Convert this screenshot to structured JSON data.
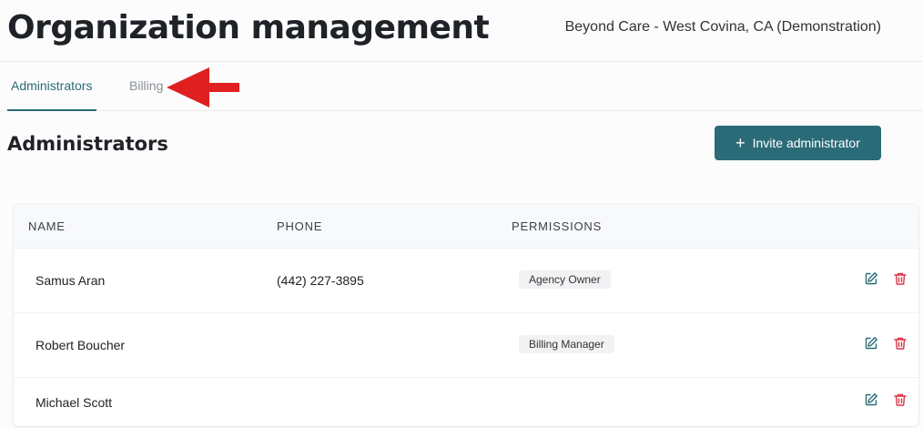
{
  "header": {
    "title": "Organization management",
    "org_name": "Beyond Care - West Covina, CA (Demonstration)"
  },
  "tabs": [
    {
      "label": "Administrators",
      "active": true
    },
    {
      "label": "Billing",
      "active": false
    }
  ],
  "section": {
    "title": "Administrators",
    "invite_button": "Invite administrator"
  },
  "table": {
    "columns": [
      "NAME",
      "PHONE",
      "PERMISSIONS"
    ],
    "rows": [
      {
        "name": "Samus Aran",
        "phone": "(442) 227-3895",
        "permission": "Agency Owner"
      },
      {
        "name": "Robert Boucher",
        "phone": "",
        "permission": "Billing Manager"
      },
      {
        "name": "Michael Scott",
        "phone": "",
        "permission": ""
      }
    ]
  },
  "colors": {
    "accent": "#2a6b77",
    "delete": "#d9364a",
    "annotation_arrow": "#e02020"
  },
  "icons": {
    "edit": "edit-icon",
    "delete": "trash-icon",
    "plus": "plus-icon"
  }
}
